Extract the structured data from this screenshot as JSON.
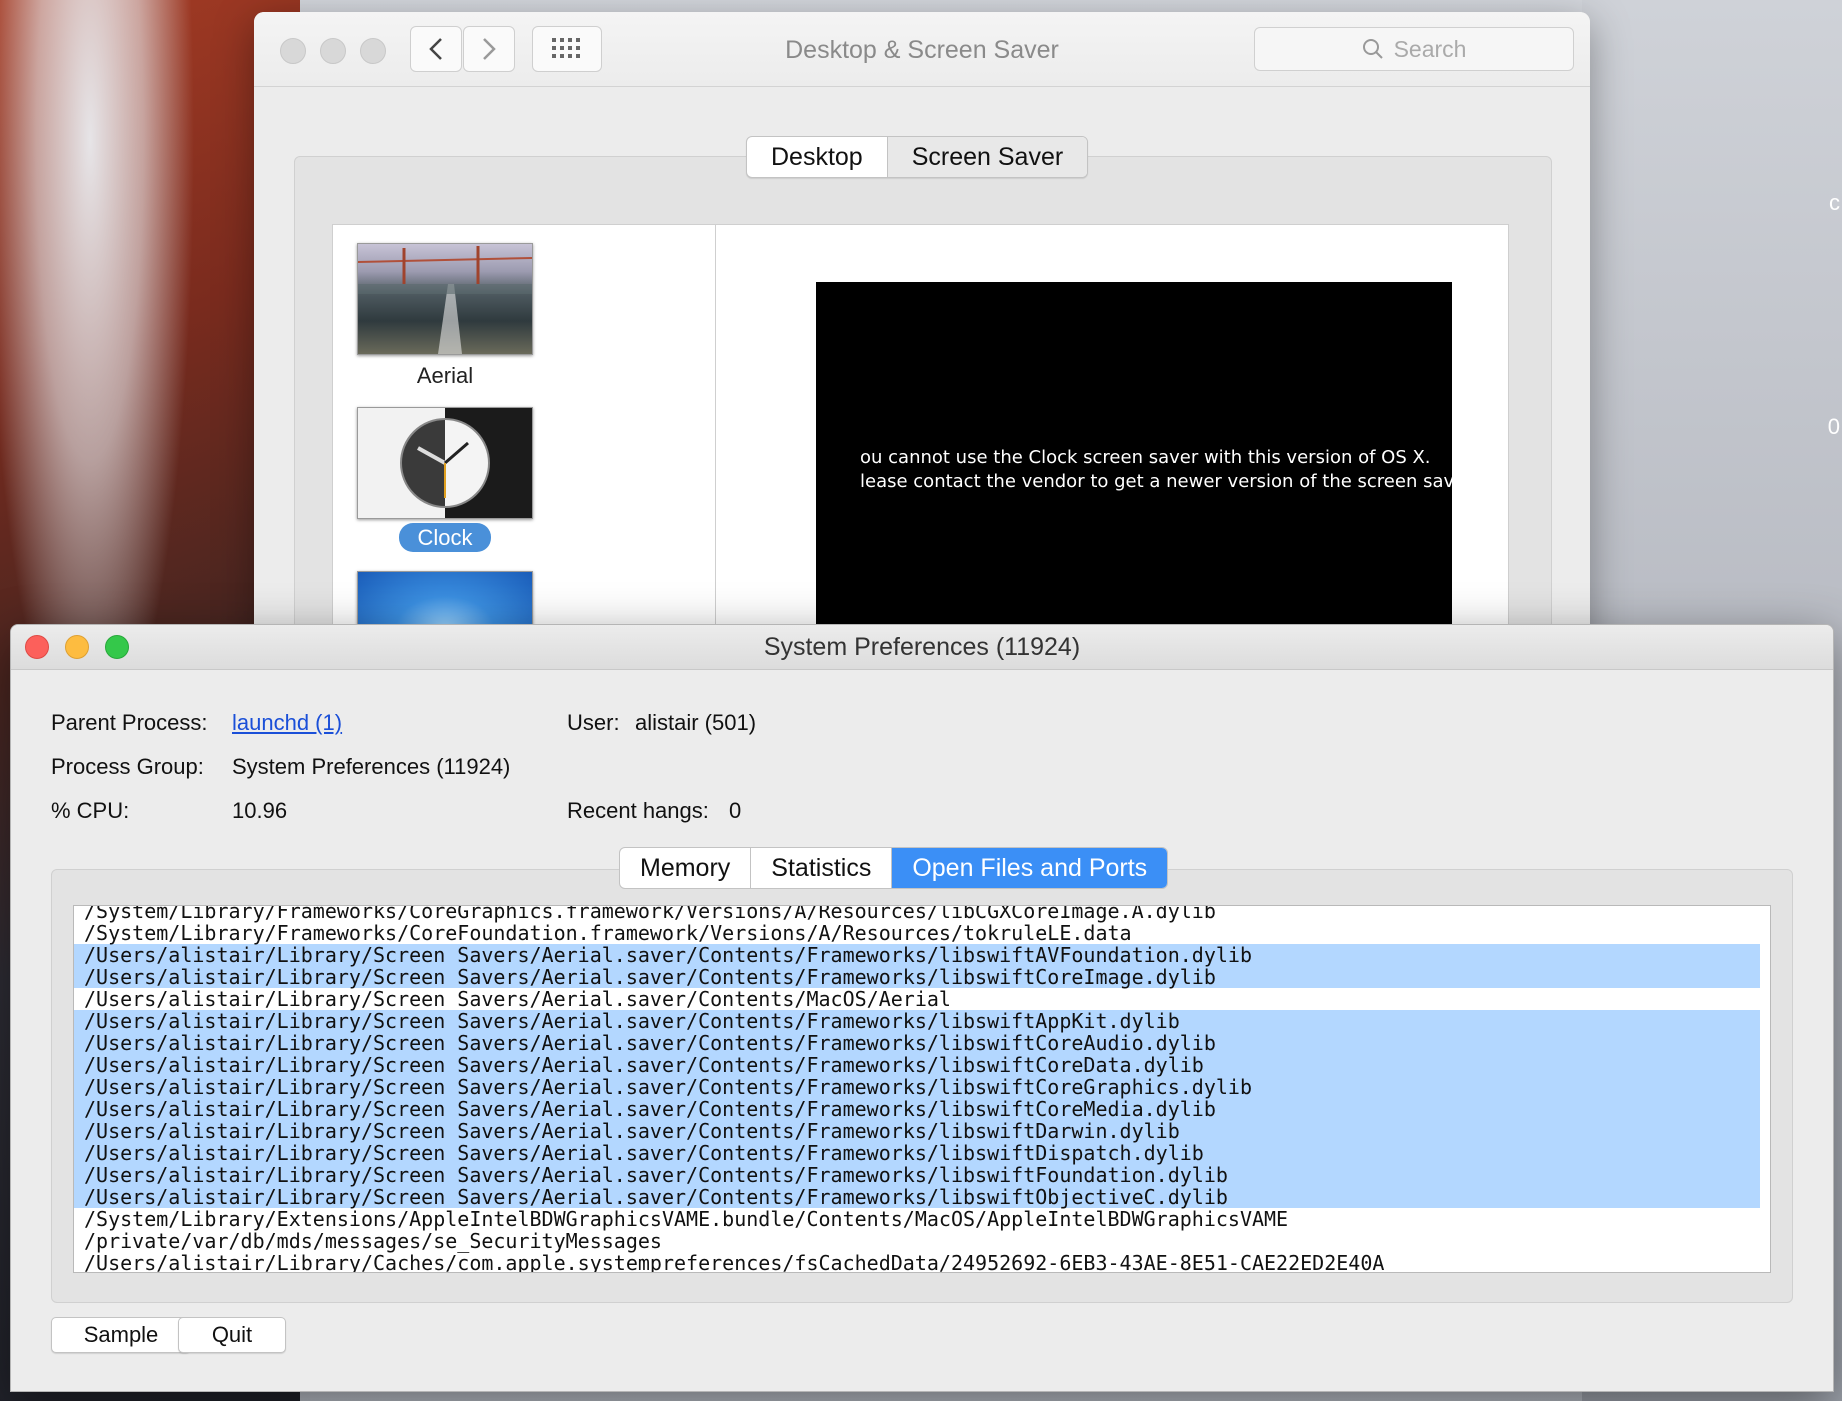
{
  "desktop": {
    "edge_glyphs": [
      "c",
      "0"
    ]
  },
  "back_window": {
    "title": "Desktop & Screen Saver",
    "search_placeholder": "Search",
    "tabs": [
      {
        "label": "Desktop",
        "selected": false
      },
      {
        "label": "Screen Saver",
        "selected": true
      }
    ],
    "savers": [
      {
        "label": "Aerial",
        "selected": false
      },
      {
        "label": "Clock",
        "selected": true
      },
      {
        "label": "",
        "selected": false
      }
    ],
    "preview_message": [
      "ou cannot use the Clock screen saver with this version of OS X.",
      "lease contact the vendor to get a newer version of the screen saver."
    ]
  },
  "front_window": {
    "title": "System Preferences (11924)",
    "info": {
      "parent_process_label": "Parent Process:",
      "parent_process_value": "launchd (1)",
      "process_group_label": "Process Group:",
      "process_group_value": "System Preferences (11924)",
      "cpu_label": "% CPU:",
      "cpu_value": "10.96",
      "user_label": "User:",
      "user_value": "alistair (501)",
      "recent_hangs_label": "Recent hangs:",
      "recent_hangs_value": "0"
    },
    "tabs": [
      {
        "label": "Memory",
        "selected": false
      },
      {
        "label": "Statistics",
        "selected": false
      },
      {
        "label": "Open Files and Ports",
        "selected": true
      }
    ],
    "files": [
      {
        "path": "/System/Library/Frameworks/CoreGraphics.framework/Versions/A/Resources/libCGXCoreImage.A.dylib",
        "selected": false
      },
      {
        "path": "/System/Library/Frameworks/CoreFoundation.framework/Versions/A/Resources/tokruleLE.data",
        "selected": false
      },
      {
        "path": "/Users/alistair/Library/Screen Savers/Aerial.saver/Contents/Frameworks/libswiftAVFoundation.dylib",
        "selected": true
      },
      {
        "path": "/Users/alistair/Library/Screen Savers/Aerial.saver/Contents/Frameworks/libswiftCoreImage.dylib",
        "selected": true
      },
      {
        "path": "/Users/alistair/Library/Screen Savers/Aerial.saver/Contents/MacOS/Aerial",
        "selected": false
      },
      {
        "path": "/Users/alistair/Library/Screen Savers/Aerial.saver/Contents/Frameworks/libswiftAppKit.dylib",
        "selected": true
      },
      {
        "path": "/Users/alistair/Library/Screen Savers/Aerial.saver/Contents/Frameworks/libswiftCoreAudio.dylib",
        "selected": true
      },
      {
        "path": "/Users/alistair/Library/Screen Savers/Aerial.saver/Contents/Frameworks/libswiftCoreData.dylib",
        "selected": true
      },
      {
        "path": "/Users/alistair/Library/Screen Savers/Aerial.saver/Contents/Frameworks/libswiftCoreGraphics.dylib",
        "selected": true
      },
      {
        "path": "/Users/alistair/Library/Screen Savers/Aerial.saver/Contents/Frameworks/libswiftCoreMedia.dylib",
        "selected": true
      },
      {
        "path": "/Users/alistair/Library/Screen Savers/Aerial.saver/Contents/Frameworks/libswiftDarwin.dylib",
        "selected": true
      },
      {
        "path": "/Users/alistair/Library/Screen Savers/Aerial.saver/Contents/Frameworks/libswiftDispatch.dylib",
        "selected": true
      },
      {
        "path": "/Users/alistair/Library/Screen Savers/Aerial.saver/Contents/Frameworks/libswiftFoundation.dylib",
        "selected": true
      },
      {
        "path": "/Users/alistair/Library/Screen Savers/Aerial.saver/Contents/Frameworks/libswiftObjectiveC.dylib",
        "selected": true
      },
      {
        "path": "/System/Library/Extensions/AppleIntelBDWGraphicsVAME.bundle/Contents/MacOS/AppleIntelBDWGraphicsVAME",
        "selected": false
      },
      {
        "path": "/private/var/db/mds/messages/se_SecurityMessages",
        "selected": false
      },
      {
        "path": "/Users/alistair/Library/Caches/com.apple.systempreferences/fsCachedData/24952692-6EB3-43AE-8E51-CAE22ED2E40A",
        "selected": false
      }
    ],
    "buttons": {
      "sample_label": "Sample",
      "quit_label": "Quit"
    }
  },
  "colors": {
    "selection": "#b3d7ff",
    "selected_tab": "#3b8ff6",
    "close": "#fc605b",
    "minimize": "#fdbc40",
    "zoom": "#34c84a",
    "link": "#1a4fd8"
  }
}
